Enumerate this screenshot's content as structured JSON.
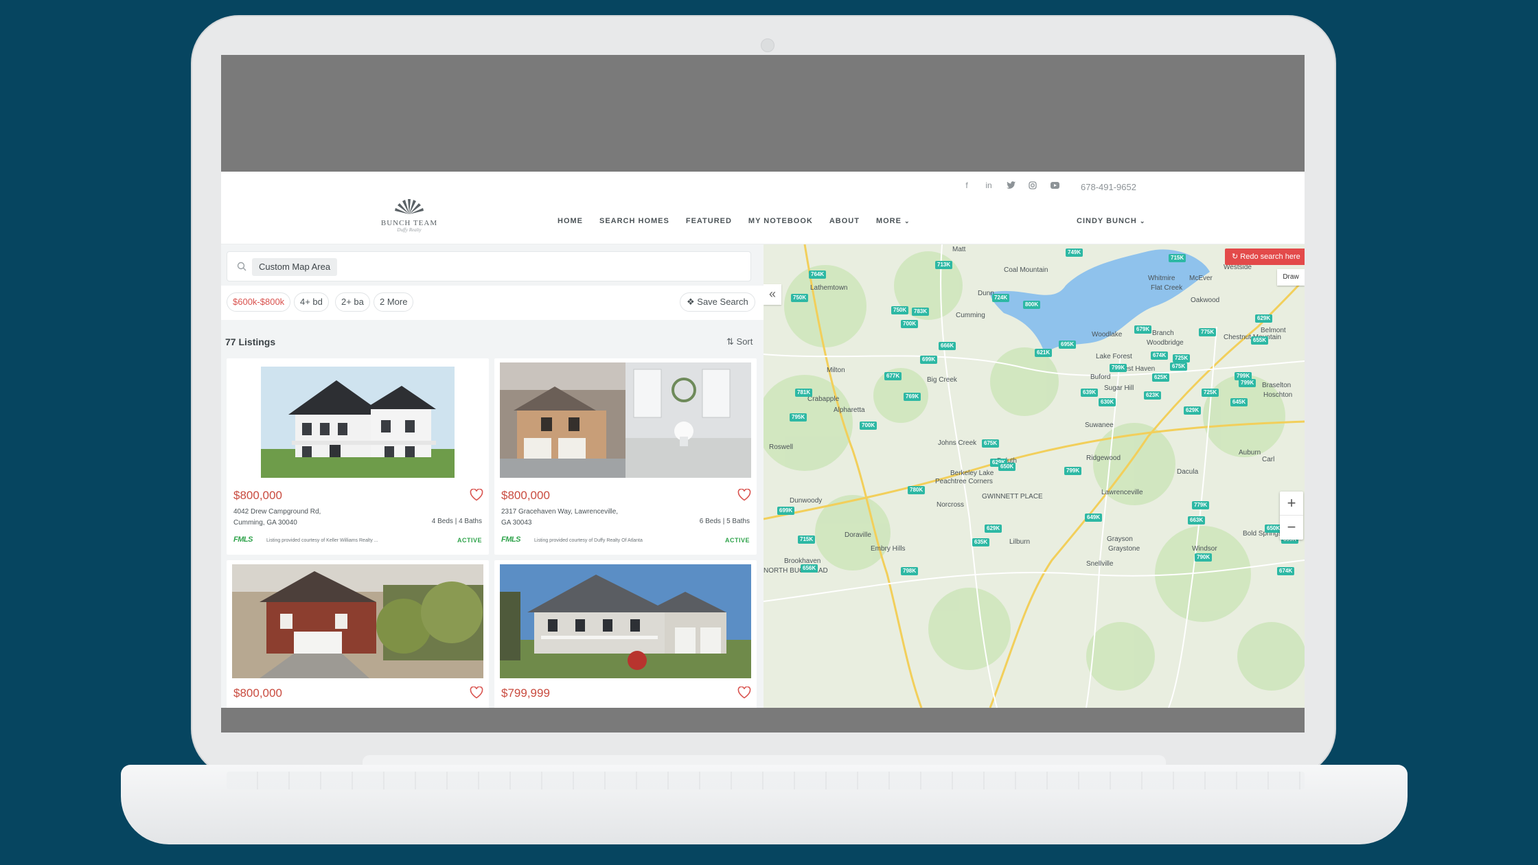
{
  "header": {
    "logo_text": "BUNCH TEAM",
    "logo_sub": "Duffy Realty",
    "phone": "678-491-9652",
    "nav": [
      "HOME",
      "SEARCH HOMES",
      "FEATURED",
      "MY NOTEBOOK",
      "ABOUT",
      "MORE"
    ],
    "user": "CINDY BUNCH",
    "social_icons": [
      "facebook-icon",
      "linkedin-icon",
      "twitter-icon",
      "instagram-icon",
      "youtube-icon"
    ]
  },
  "search": {
    "chip": "Custom Map Area"
  },
  "filters": {
    "price": "$600k-$800k",
    "beds": "4+ bd",
    "baths": "2+ ba",
    "more": "2 More",
    "save_search": "Save Search"
  },
  "results": {
    "count_label": "77 Listings",
    "sort_label": "Sort"
  },
  "listings": [
    {
      "price": "$800,000",
      "address_line1": "4042 Drew Campground Rd,",
      "address_line2": "Cumming, GA 30040",
      "beds_baths": "4 Beds | 4 Baths",
      "mls": "FMLS",
      "courtesy": "Listing provided courtesy of Keller Williams Realty ...",
      "status": "ACTIVE"
    },
    {
      "price": "$800,000",
      "address_line1": "2317 Gracehaven Way, Lawrenceville,",
      "address_line2": "GA 30043",
      "beds_baths": "6 Beds | 5 Baths",
      "mls": "FMLS",
      "courtesy": "Listing provided courtesy of Duffy Realty Of Atlanta",
      "status": "ACTIVE"
    },
    {
      "price": "$800,000"
    },
    {
      "price": "$799,999"
    }
  ],
  "map": {
    "redo_label": "Redo search here",
    "draw_label": "Draw",
    "pin_color": "#2db8a4",
    "pins": [
      {
        "label": "749K"
      },
      {
        "label": "715K"
      },
      {
        "label": "713K"
      },
      {
        "label": "764K"
      },
      {
        "label": "750K"
      },
      {
        "label": "724K"
      },
      {
        "label": "800K"
      },
      {
        "label": "750K"
      },
      {
        "label": "783K"
      },
      {
        "label": "700K"
      },
      {
        "label": "629K"
      },
      {
        "label": "666K"
      },
      {
        "label": "695K"
      },
      {
        "label": "621K"
      },
      {
        "label": "699K"
      },
      {
        "label": "679K"
      },
      {
        "label": "775K"
      },
      {
        "label": "655K"
      },
      {
        "label": "674K"
      },
      {
        "label": "725K"
      },
      {
        "label": "675K"
      },
      {
        "label": "799K"
      },
      {
        "label": "625K"
      },
      {
        "label": "799K"
      },
      {
        "label": "799K"
      },
      {
        "label": "677K"
      },
      {
        "label": "781K"
      },
      {
        "label": "769K"
      },
      {
        "label": "639K"
      },
      {
        "label": "623K"
      },
      {
        "label": "630K"
      },
      {
        "label": "725K"
      },
      {
        "label": "645K"
      },
      {
        "label": "629K"
      },
      {
        "label": "795K"
      },
      {
        "label": "700K"
      },
      {
        "label": "675K"
      },
      {
        "label": "629K"
      },
      {
        "label": "650K"
      },
      {
        "label": "799K"
      },
      {
        "label": "780K"
      },
      {
        "label": "779K"
      },
      {
        "label": "699K"
      },
      {
        "label": "649K"
      },
      {
        "label": "663K"
      },
      {
        "label": "629K"
      },
      {
        "label": "635K"
      },
      {
        "label": "650K"
      },
      {
        "label": "715K"
      },
      {
        "label": "699K"
      },
      {
        "label": "790K"
      },
      {
        "label": "656K"
      },
      {
        "label": "798K"
      },
      {
        "label": "674K"
      }
    ],
    "places": [
      {
        "name": "Matt"
      },
      {
        "name": "Coal Mountain"
      },
      {
        "name": "Whitmire"
      },
      {
        "name": "McEver"
      },
      {
        "name": "Flat Creek"
      },
      {
        "name": "Oakwood"
      },
      {
        "name": "Westside"
      },
      {
        "name": "Lathemtown"
      },
      {
        "name": "Dunn"
      },
      {
        "name": "Cumming"
      },
      {
        "name": "Woodlake"
      },
      {
        "name": "Branch"
      },
      {
        "name": "Woodbridge"
      },
      {
        "name": "Chestnut Mountain"
      },
      {
        "name": "Belmont"
      },
      {
        "name": "Lake Forest"
      },
      {
        "name": "Rest Haven"
      },
      {
        "name": "Buford"
      },
      {
        "name": "Milton"
      },
      {
        "name": "Big Creek"
      },
      {
        "name": "Sugar Hill"
      },
      {
        "name": "Braselton"
      },
      {
        "name": "Hoschton"
      },
      {
        "name": "Crabapple"
      },
      {
        "name": "Alpharetta"
      },
      {
        "name": "Suwanee"
      },
      {
        "name": "Johns Creek"
      },
      {
        "name": "Roswell"
      },
      {
        "name": "Duluth"
      },
      {
        "name": "Berkeley Lake"
      },
      {
        "name": "Ridgewood"
      },
      {
        "name": "Dacula"
      },
      {
        "name": "Auburn"
      },
      {
        "name": "Carl"
      },
      {
        "name": "Peachtree Corners"
      },
      {
        "name": "GWINNETT PLACE"
      },
      {
        "name": "Lawrenceville"
      },
      {
        "name": "Dunwoody"
      },
      {
        "name": "Norcross"
      },
      {
        "name": "Doraville"
      },
      {
        "name": "Lilburn"
      },
      {
        "name": "Grayson"
      },
      {
        "name": "Bold Springs"
      },
      {
        "name": "Embry Hills"
      },
      {
        "name": "Brookhaven"
      },
      {
        "name": "Graystone"
      },
      {
        "name": "Windsor"
      },
      {
        "name": "Snellville"
      },
      {
        "name": "NORTH BUCKHEAD"
      }
    ]
  }
}
